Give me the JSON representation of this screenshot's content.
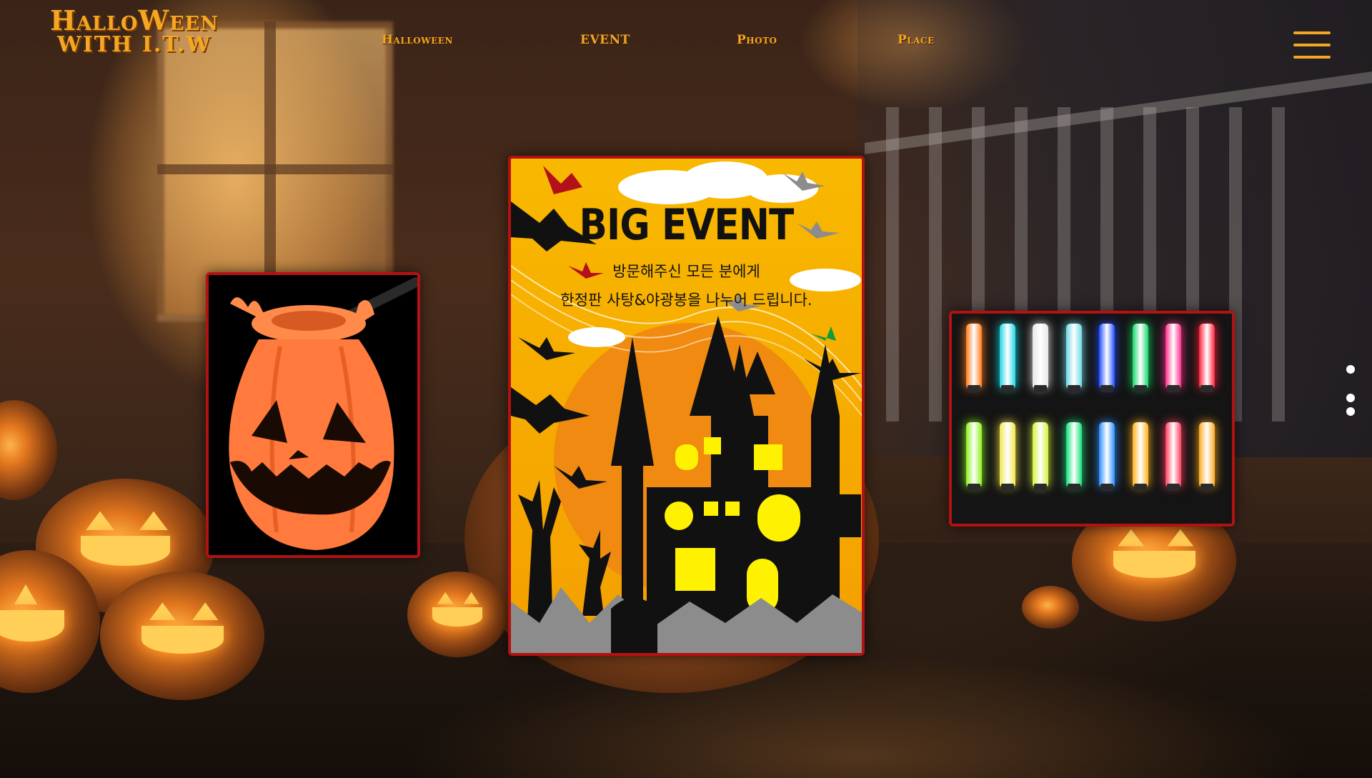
{
  "header": {
    "logo_line1": "HalloWeen",
    "logo_line2": "WITH I.T.W"
  },
  "nav": {
    "items": [
      {
        "label": "Halloween"
      },
      {
        "label": "EVENT"
      },
      {
        "label": "Photo"
      },
      {
        "label": "Place"
      }
    ]
  },
  "poster": {
    "title": "BIG EVENT",
    "line1": "방문해주신 모든 분에게",
    "line2": "한정판 사탕&야광봉을 나누어 드립니다."
  },
  "glowsticks": {
    "top_row_colors": [
      "#ff7a1a",
      "#19d6e6",
      "#e6e6e6",
      "#6fd8e6",
      "#1f4dff",
      "#16d96a",
      "#ff2e8a",
      "#ff1f3a"
    ],
    "bottom_row_colors": [
      "#8cf21c",
      "#f2e64a",
      "#d7f23a",
      "#18e07a",
      "#2a8cff",
      "#ffb21a",
      "#ff3d5e",
      "#ffa81f"
    ]
  },
  "colors": {
    "accent": "#f5a623",
    "card_border": "#b31212"
  },
  "pager": {
    "count": 3
  }
}
